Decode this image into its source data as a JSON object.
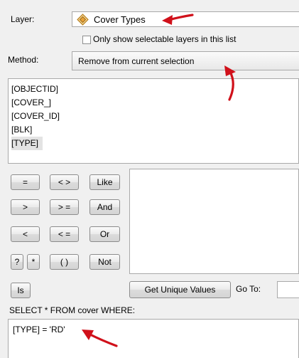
{
  "layer": {
    "label": "Layer:",
    "value": "Cover Types",
    "icon": "layer-diamond-icon",
    "only_selectable_label": "Only show selectable layers in this list",
    "only_selectable_checked": false
  },
  "method": {
    "label": "Method:",
    "value": "Remove from current selection"
  },
  "fields": [
    "[OBJECTID]",
    "[COVER_]",
    "[COVER_ID]",
    "[BLK]",
    "[TYPE]"
  ],
  "selected_field": "[TYPE]",
  "operators": {
    "eq": "=",
    "ne": "< >",
    "like": "Like",
    "gt": ">",
    "ge": "> =",
    "and": "And",
    "lt": "<",
    "le": "< =",
    "or": "Or",
    "q": "?",
    "star": "*",
    "parens": "( )",
    "not": "Not",
    "is": "Is"
  },
  "get_unique_values_label": "Get Unique Values",
  "goto_label": "Go To:",
  "goto_value": "",
  "sql_header": "SELECT * FROM cover WHERE:",
  "expression": "[TYPE] = 'RD'",
  "colors": {
    "arrow": "#d0101a",
    "selected_bg": "#e3e3e3",
    "layer_icon": "#e8a23a"
  }
}
